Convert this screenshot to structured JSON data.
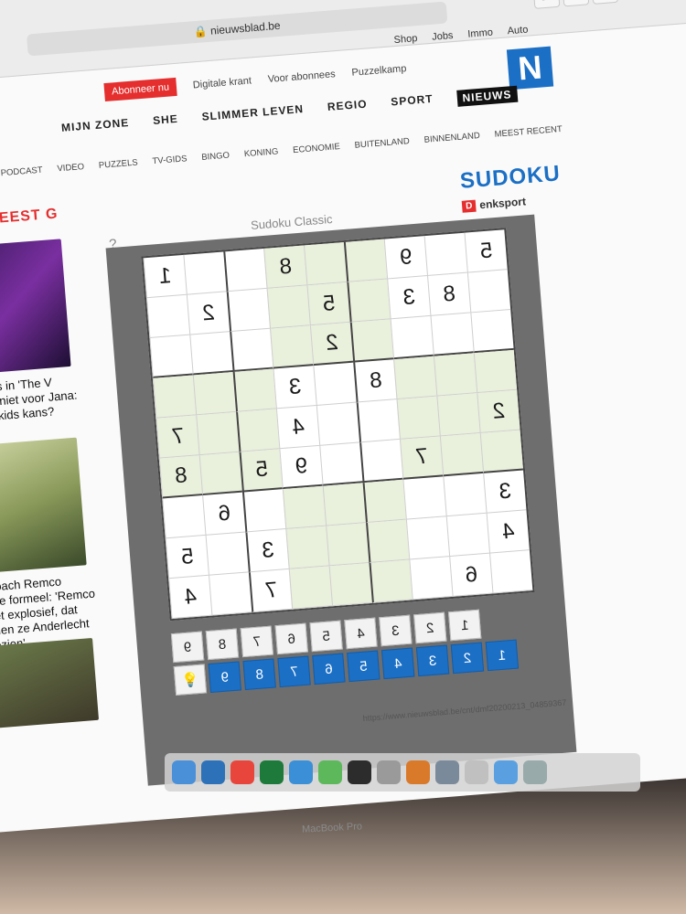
{
  "browser": {
    "url": "nieuwsblad.be",
    "bookmarks": [
      "Auto",
      "Immo",
      "Jobs",
      "Shop"
    ],
    "status_url": "https://www.nieuwsblad.be/cnt/dmf20200213_04859367"
  },
  "site": {
    "logo": "N",
    "top_links": [
      "Puzzelkamp",
      "Voor abonnees",
      "Digitale krant"
    ],
    "subscribe_label": "Abonneer nu",
    "main_nav": [
      "NIEUWS",
      "SPORT",
      "REGIO",
      "SLIMMER LEVEN",
      "SHE",
      "MIJN ZONE"
    ],
    "sub_nav": [
      "MEEST RECENT",
      "BINNENLAND",
      "BUITENLAND",
      "ECONOMIE",
      "KONING",
      "BINGO",
      "TV-GIDS",
      "PUZZELS",
      "VIDEO",
      "PODCAST"
    ]
  },
  "page": {
    "section_title": "SUDOKU",
    "provider_badge": "D",
    "provider": "enksport",
    "puzzle_title": "Sudoku Classic",
    "help": "?"
  },
  "sudoku": {
    "grid": [
      [
        1,
        null,
        null,
        8,
        null,
        null,
        9,
        null,
        5
      ],
      [
        null,
        2,
        null,
        null,
        5,
        null,
        3,
        8,
        null
      ],
      [
        null,
        null,
        null,
        null,
        2,
        null,
        null,
        null,
        null
      ],
      [
        null,
        null,
        null,
        3,
        null,
        8,
        null,
        null,
        null
      ],
      [
        7,
        null,
        null,
        4,
        null,
        null,
        null,
        null,
        2
      ],
      [
        8,
        null,
        5,
        9,
        null,
        null,
        7,
        null,
        null
      ],
      [
        null,
        6,
        null,
        null,
        null,
        null,
        null,
        null,
        3
      ],
      [
        5,
        null,
        3,
        null,
        null,
        null,
        null,
        null,
        4
      ],
      [
        4,
        null,
        7,
        null,
        null,
        null,
        null,
        6,
        null
      ]
    ],
    "green_blocks": [
      [
        0,
        1
      ],
      [
        1,
        0
      ],
      [
        1,
        2
      ],
      [
        2,
        1
      ]
    ]
  },
  "number_pad": {
    "row_gray": [
      "9",
      "8",
      "7",
      "6",
      "5",
      "4",
      "3",
      "2",
      "1"
    ],
    "row_blue": [
      "bulb",
      "9",
      "8",
      "7",
      "6",
      "5",
      "4",
      "3",
      "2",
      "1"
    ]
  },
  "sidebar": {
    "heading": "MEEST G",
    "articles": [
      {
        "caption": "Coaches in 'The V draaien niet voor Jana: krijgen 'kids kans?"
      },
      {
        "caption": "Ex-coach Remco Evene formeel: 'Remco is niet explosief, dat hadden ze Anderlecht al gezien'"
      }
    ]
  },
  "bezel_label": "MacBook Pro",
  "colors": {
    "brand_blue": "#1b6fc5",
    "accent_red": "#e52e2e",
    "grid_green": "#e9f0dc"
  }
}
